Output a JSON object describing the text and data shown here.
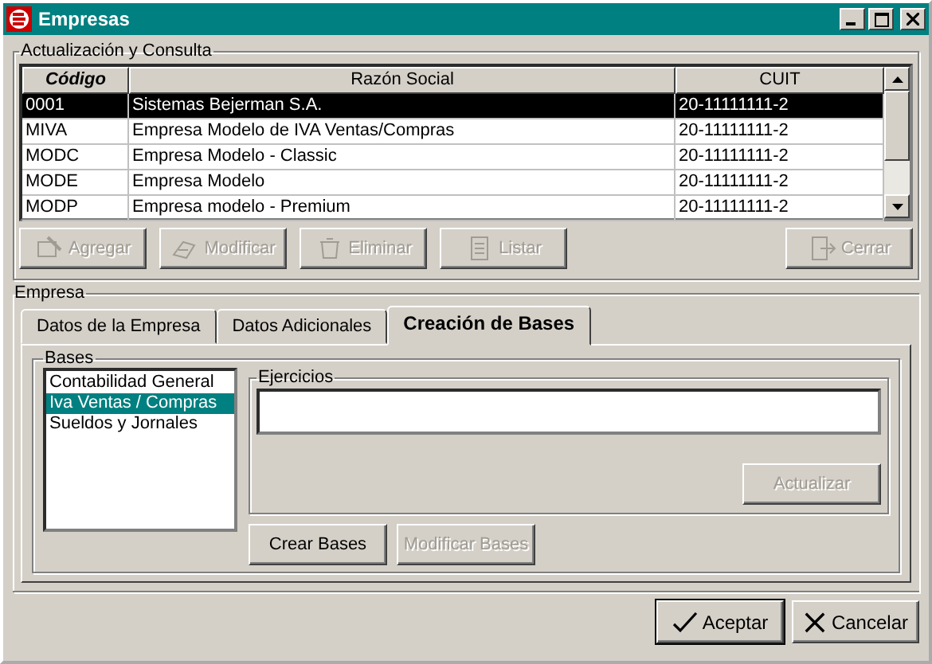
{
  "window": {
    "title": "Empresas"
  },
  "consulta": {
    "title": "Actualización y Consulta",
    "table": {
      "columns": [
        "Código",
        "Razón Social",
        "CUIT"
      ],
      "rows": [
        {
          "cells": [
            "0001",
            "Sistemas Bejerman S.A.",
            "20-11111111-2"
          ],
          "selected": true
        },
        {
          "cells": [
            "MIVA",
            "Empresa Modelo de IVA Ventas/Compras",
            "20-11111111-2"
          ],
          "selected": false
        },
        {
          "cells": [
            "MODC",
            "Empresa Modelo - Classic",
            "20-11111111-2"
          ],
          "selected": false
        },
        {
          "cells": [
            "MODE",
            "Empresa Modelo",
            "20-11111111-2"
          ],
          "selected": false
        },
        {
          "cells": [
            "MODP",
            "Empresa modelo - Premium",
            "20-11111111-2"
          ],
          "selected": false
        }
      ]
    },
    "buttons": [
      {
        "label": "Agregar",
        "kind": "add",
        "disabled": true
      },
      {
        "label": "Modificar",
        "kind": "edit",
        "disabled": true
      },
      {
        "label": "Eliminar",
        "kind": "delete",
        "disabled": true
      },
      {
        "label": "Listar",
        "kind": "list",
        "disabled": true
      }
    ],
    "close_button": {
      "label": "Cerrar",
      "disabled": true
    }
  },
  "empresa": {
    "title": "Empresa",
    "tabs": [
      {
        "label": "Datos de la Empresa",
        "selected": false
      },
      {
        "label": "Datos Adicionales",
        "selected": false
      },
      {
        "label": "Creación de Bases",
        "selected": true
      }
    ],
    "bases": {
      "title": "Bases",
      "items": [
        {
          "label": "Contabilidad General",
          "selected": false
        },
        {
          "label": "Iva Ventas / Compras",
          "selected": true
        },
        {
          "label": "Sueldos y Jornales",
          "selected": false
        }
      ]
    },
    "ejercicios": {
      "title": "Ejercicios",
      "update_button": {
        "label": "Actualizar",
        "disabled": true
      }
    },
    "create_button": {
      "label": "Crear Bases",
      "disabled": false
    },
    "modify_button": {
      "label": "Modificar Bases",
      "disabled": true
    }
  },
  "footer": [
    {
      "label": "Aceptar",
      "kind": "accept"
    },
    {
      "label": "Cancelar",
      "kind": "cancel"
    }
  ]
}
